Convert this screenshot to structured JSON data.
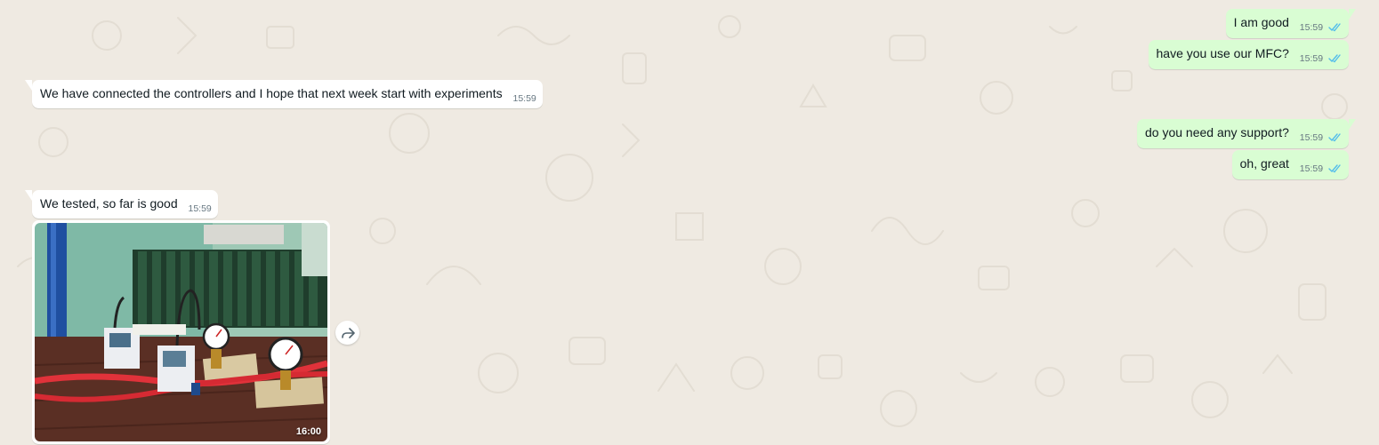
{
  "chat": {
    "messages": [
      {
        "id": "m1",
        "direction": "out",
        "text": "I am good",
        "time": "15:59",
        "status": "read"
      },
      {
        "id": "m2",
        "direction": "out",
        "text": "have you use our MFC?",
        "time": "15:59",
        "status": "read"
      },
      {
        "id": "m3",
        "direction": "in",
        "text": "We have connected the controllers and I hope that next week start with experiments",
        "time": "15:59"
      },
      {
        "id": "m4",
        "direction": "out",
        "text": "do you need any support?",
        "time": "15:59",
        "status": "read"
      },
      {
        "id": "m5",
        "direction": "out",
        "text": "oh, great",
        "time": "15:59",
        "status": "read"
      },
      {
        "id": "m6",
        "direction": "in",
        "text": "We tested, so far is good",
        "time": "15:59"
      }
    ],
    "photo_message": {
      "time": "16:00",
      "icon": "forward-icon"
    }
  },
  "colors": {
    "background": "#efeae2",
    "incoming_bubble": "#ffffff",
    "outgoing_bubble": "#d9fdd3",
    "timestamp": "#667781",
    "read_ticks": "#53bdeb"
  }
}
